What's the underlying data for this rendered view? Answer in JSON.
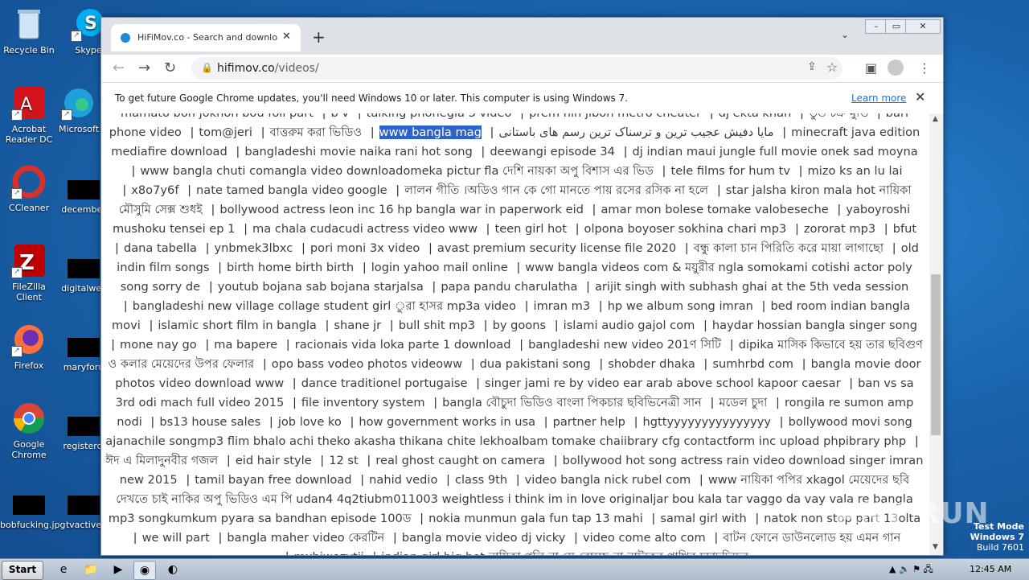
{
  "desktop": {
    "icons": [
      {
        "label": "Recycle Bin",
        "icon": "recycle-bin-icon"
      },
      {
        "label": "Skype",
        "icon": "skype-icon"
      },
      {
        "label": "Acrobat Reader DC",
        "icon": "acrobat-icon"
      },
      {
        "label": "Microsoft",
        "icon": "edge-icon"
      },
      {
        "label": "CCleaner",
        "icon": "ccleaner-icon"
      },
      {
        "label": "december",
        "icon": "black-file-icon"
      },
      {
        "label": "FileZilla Client",
        "icon": "filezilla-icon"
      },
      {
        "label": "digitalwes",
        "icon": "black-file-icon"
      },
      {
        "label": "Firefox",
        "icon": "firefox-icon"
      },
      {
        "label": "maryforu",
        "icon": "black-file-icon"
      },
      {
        "label": "Google Chrome",
        "icon": "chrome-icon"
      },
      {
        "label": "registercl",
        "icon": "black-file-icon"
      },
      {
        "label": "bobfucking.jpg",
        "icon": "black-file-icon"
      },
      {
        "label": "tvactive",
        "icon": "black-file-icon"
      }
    ]
  },
  "browser": {
    "tab_title": "HiFiMov.co - Search and download a",
    "url_host": "hifimov.co",
    "url_path": "/videos/",
    "infobar_message": "To get future Google Chrome updates, you'll need Windows 10 or later. This computer is using Windows 7.",
    "infobar_link": "Learn more"
  },
  "page": {
    "tags": [
      "mamato bon jokhon bou foll part",
      "b v",
      "talking phonegla 3 video",
      "prem hin jibon metro cheater",
      "dj ekta khan",
      "ভুত চক্র মুভি",
      "bari phone video",
      "tom@jeri",
      "বাত্তরুম করা ভিডিও",
      "www bangla mag",
      "مایا دفیش عجیب ترین و ترسناک ترین رسم های باستانی",
      "minecraft java edition mediafire download",
      "bangladeshi movie naika rani hot song",
      "deewangi episode 34",
      "dj indian maui jungle full movie onek sad moyna",
      "www bangla chuti comangla video downloadomeka pictur fla দেশি নায়কা অপু বিশাস এর ভিড",
      "tele films for hum tv",
      "mizo ks an lu lai",
      "x8o7y6f",
      "nate tamed bangla video google",
      "লালন গীতি ।অডিও গান কে গো মানতে পায় রসের রসিক না হলে",
      "star jalsha kiron mala hot নায়িকা মৌসুমি সেক্স শুধই",
      "bollywood actress leon inc 16 hp bangla war in paperwork eid",
      "amar mon bolese tomake valobeseche",
      "yaboyroshi mushoku tensei ep 1",
      "ma chala cudacudi actress video www",
      "teen girl hot",
      "olpona boyoser sokhina chari mp3",
      "zororat mp3",
      "bfut",
      "dana tabella",
      "ynbmek3lbxc",
      "pori moni 3x video",
      "avast premium security license file 2020",
      "বন্ধু কালা চান পিরিতি করে মায়া লাগাছো",
      "old indin film songs",
      "birth home birth birth",
      "login yahoo mail online",
      "www bangla videos com & ময়ুরীর ngla somokami cotishi actor poly song sorry de",
      "youtub bojana sab bojana starjalsa",
      "papa pandu charulatha",
      "arijit singh with subhash ghai at the 5th veda session",
      "bangladeshi new village collage student girl ুরা হাসর mp3a video",
      "imran m3",
      "hp we album song imran",
      "bed room indian bangla movi",
      "islamic short film in bangla",
      "shane jr",
      "bull shit mp3",
      "by goons",
      "islami audio gajol com",
      "haydar hossian bangla singer song",
      "mone nay go",
      "ma bapere",
      "racionais vida loka parte 1 download",
      "bangladeshi new video 201ণ সিটি",
      "dipika মাসিক কিভাবে হয় তার ছবিগুণ ও কলার মেয়েদের উপর ফেলার",
      "opo bass vodeo photos videoww",
      "dua pakistani song",
      "shobder dhaka",
      "sumhrbd com",
      "bangla movie door photos video download www",
      "dance traditionel portugaise",
      "singer jami re by video ear arab above school kapoor caesar",
      "ban vs sa 3rd odi mach full video 2015",
      "file inventory system",
      "bangla বৌচুদা ভিডিও বাংলা পিকচার ছবিভিনেত্রী সান",
      "মডেল চুদা",
      "rongila re sumon amp nodi",
      "bs13 house sales",
      "job love ko",
      "how government works in usa",
      "partner help",
      "hgttyyyyyyyyyyyyyyy",
      "bollywood movi song ajanachile songmp3 flim bhalo achi theko akasha thikana chite lekhoalbam tomake chaiibrary cfg contactform inc upload phpibrary php",
      "ঈদ এ মিলাদুনবীর গজল",
      "eid hair style",
      "12 st",
      "real ghost caught on camera",
      "bollywood hot song actress rain video download singer imran new 2015",
      "tamil bayan free download",
      "nahid vedio",
      "class 9th",
      "video bangla nick rubel com",
      "www নায়িকা পপির xkagol মেয়েদের ছবি দেখতে চাই নাকির অপু ভিডিও এম পি udan4 4q2tiubm011003 weightless i think im in love originaljar bou kala tar vaggo da vay vala re bangla mp3 songkumkum pyara sa bandhan episode 100ড",
      "nokia munmun gala fun tap 13 mahi",
      "samal girl with",
      "natok non stop part 13olta",
      "we will part",
      "bangla maher video কেরটিন",
      "bangla movie video dj vicky",
      "video come alto com",
      "বাটন ফোনে ডাউনলোড হয় এমন গান",
      "mxhjwezvtii",
      "indian girl big hot নায়িকা পলি না সে বোচ্ছে না নাটকের পাখির চুচাদুদিদের"
    ]
  },
  "taskbar": {
    "start_label": "Start",
    "clock": "12:45 AM"
  },
  "watermark": {
    "line1": "Test Mode",
    "line2": "Windows 7",
    "line3": "Build 7601",
    "brand": "ANY RUN"
  }
}
